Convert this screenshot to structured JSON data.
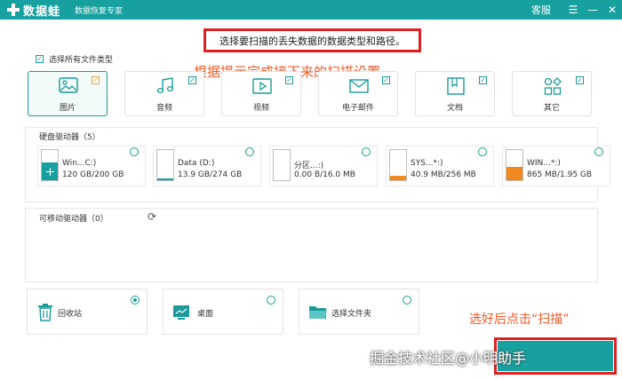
{
  "titlebar": {
    "app_name": "数据蛙",
    "app_subtitle": "数据恢复专家",
    "service": "客服",
    "menu_glyph": "☰",
    "minimize_glyph": "—",
    "close_glyph": "✕",
    "brand_color": "#17a0a0"
  },
  "instruction": "选择要扫描的丢失数据的数据类型和路径。",
  "hint": "根据提示完成接下来的扫描设置",
  "select_all": {
    "label": "选择所有文件类型",
    "checked": true
  },
  "file_types": [
    {
      "label": "图片",
      "icon": "image-icon",
      "checked": true,
      "selected": true
    },
    {
      "label": "音频",
      "icon": "music-icon",
      "checked": true
    },
    {
      "label": "视频",
      "icon": "video-icon",
      "checked": true
    },
    {
      "label": "电子邮件",
      "icon": "mail-icon",
      "checked": true
    },
    {
      "label": "文档",
      "icon": "document-icon",
      "checked": true
    },
    {
      "label": "其它",
      "icon": "other-icon",
      "checked": true
    }
  ],
  "hard_drives": {
    "title": "硬盘驱动器（5）",
    "items": [
      {
        "name": "Win...C:)",
        "size": "120 GB/200 GB",
        "used_fraction": 0.6,
        "color": "#17a0a0",
        "windows": true
      },
      {
        "name": "Data (D:)",
        "size": "13.9 GB/274 GB",
        "used_fraction": 0.05,
        "color": "#17a0a0"
      },
      {
        "name": "分区...:)",
        "size": "0.00  B/16.0 MB",
        "used_fraction": 0.0,
        "color": "#e8a040"
      },
      {
        "name": "SYS...*:)",
        "size": "40.9 MB/256 MB",
        "used_fraction": 0.16,
        "color": "#f08a20"
      },
      {
        "name": "WIN...*:)",
        "size": "865 MB/1.95 GB",
        "used_fraction": 0.44,
        "color": "#f08a20"
      }
    ]
  },
  "removable": {
    "title": "可移动驱动器（0）"
  },
  "locations": [
    {
      "label": "回收站",
      "icon": "recycle-bin-icon",
      "selected": true
    },
    {
      "label": "桌面",
      "icon": "desktop-icon",
      "selected": false
    },
    {
      "label": "选择文件夹",
      "icon": "folder-icon",
      "selected": false
    }
  ],
  "hint2": "选好后点击“扫描”",
  "watermark": "掘金技术社区@小明助手",
  "scan_button": ""
}
